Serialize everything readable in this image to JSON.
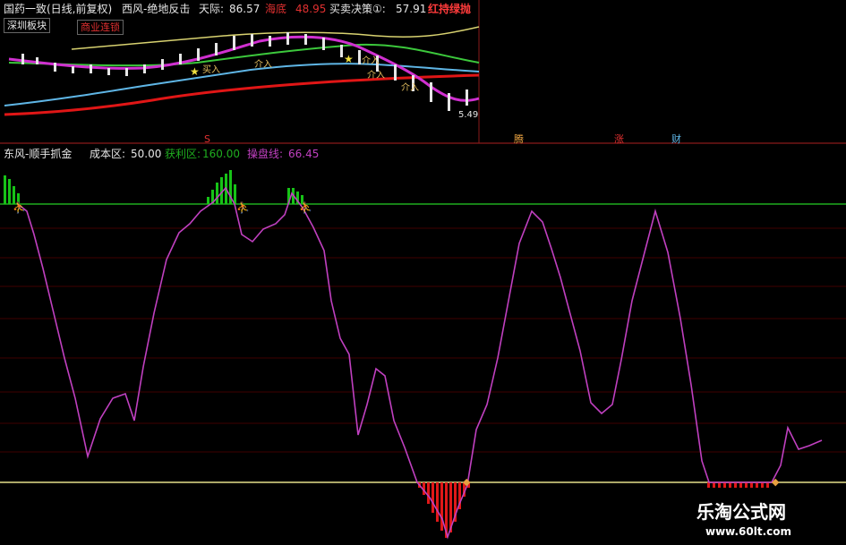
{
  "top_panel": {
    "stock_title": "国药一致(日线,前复权)",
    "indicator_name": "西风-绝地反击",
    "tianji_label": "天际:",
    "tianji_value": "86.57",
    "haidi_label": "海底",
    "haidi_value": "48.95",
    "maimai_label": "买卖决策①:",
    "maimai_value": "57.91",
    "right_tag": "红持绿抛",
    "sector_box": "深圳板块",
    "business_box": "商业连锁",
    "signals": [
      "买入",
      "介入",
      "介入",
      "介入",
      "介入"
    ],
    "bottom_right_label": "5.49"
  },
  "markers": {
    "s_label": "S",
    "m1": "腾",
    "m2": "涨",
    "m3": "财"
  },
  "lower_panel": {
    "name": "东风-顺手抓金",
    "cost_label": "成本区:",
    "cost_value": "50.00",
    "profit_label": "获利区:",
    "profit_value": "160.00",
    "trader_label": "操盘线:",
    "trader_value": "66.45"
  },
  "colors": {
    "background": "#000000",
    "magenta_line": "#c040c0",
    "green_level": "#1fae1f",
    "yellow_level": "#e6e08a",
    "red_grid": "#5a0000",
    "red_bar": "#e01818",
    "green_bar": "#17c217"
  },
  "watermark": {
    "site_name": "乐淘公式网",
    "site_url": "www.60lt.com"
  }
}
